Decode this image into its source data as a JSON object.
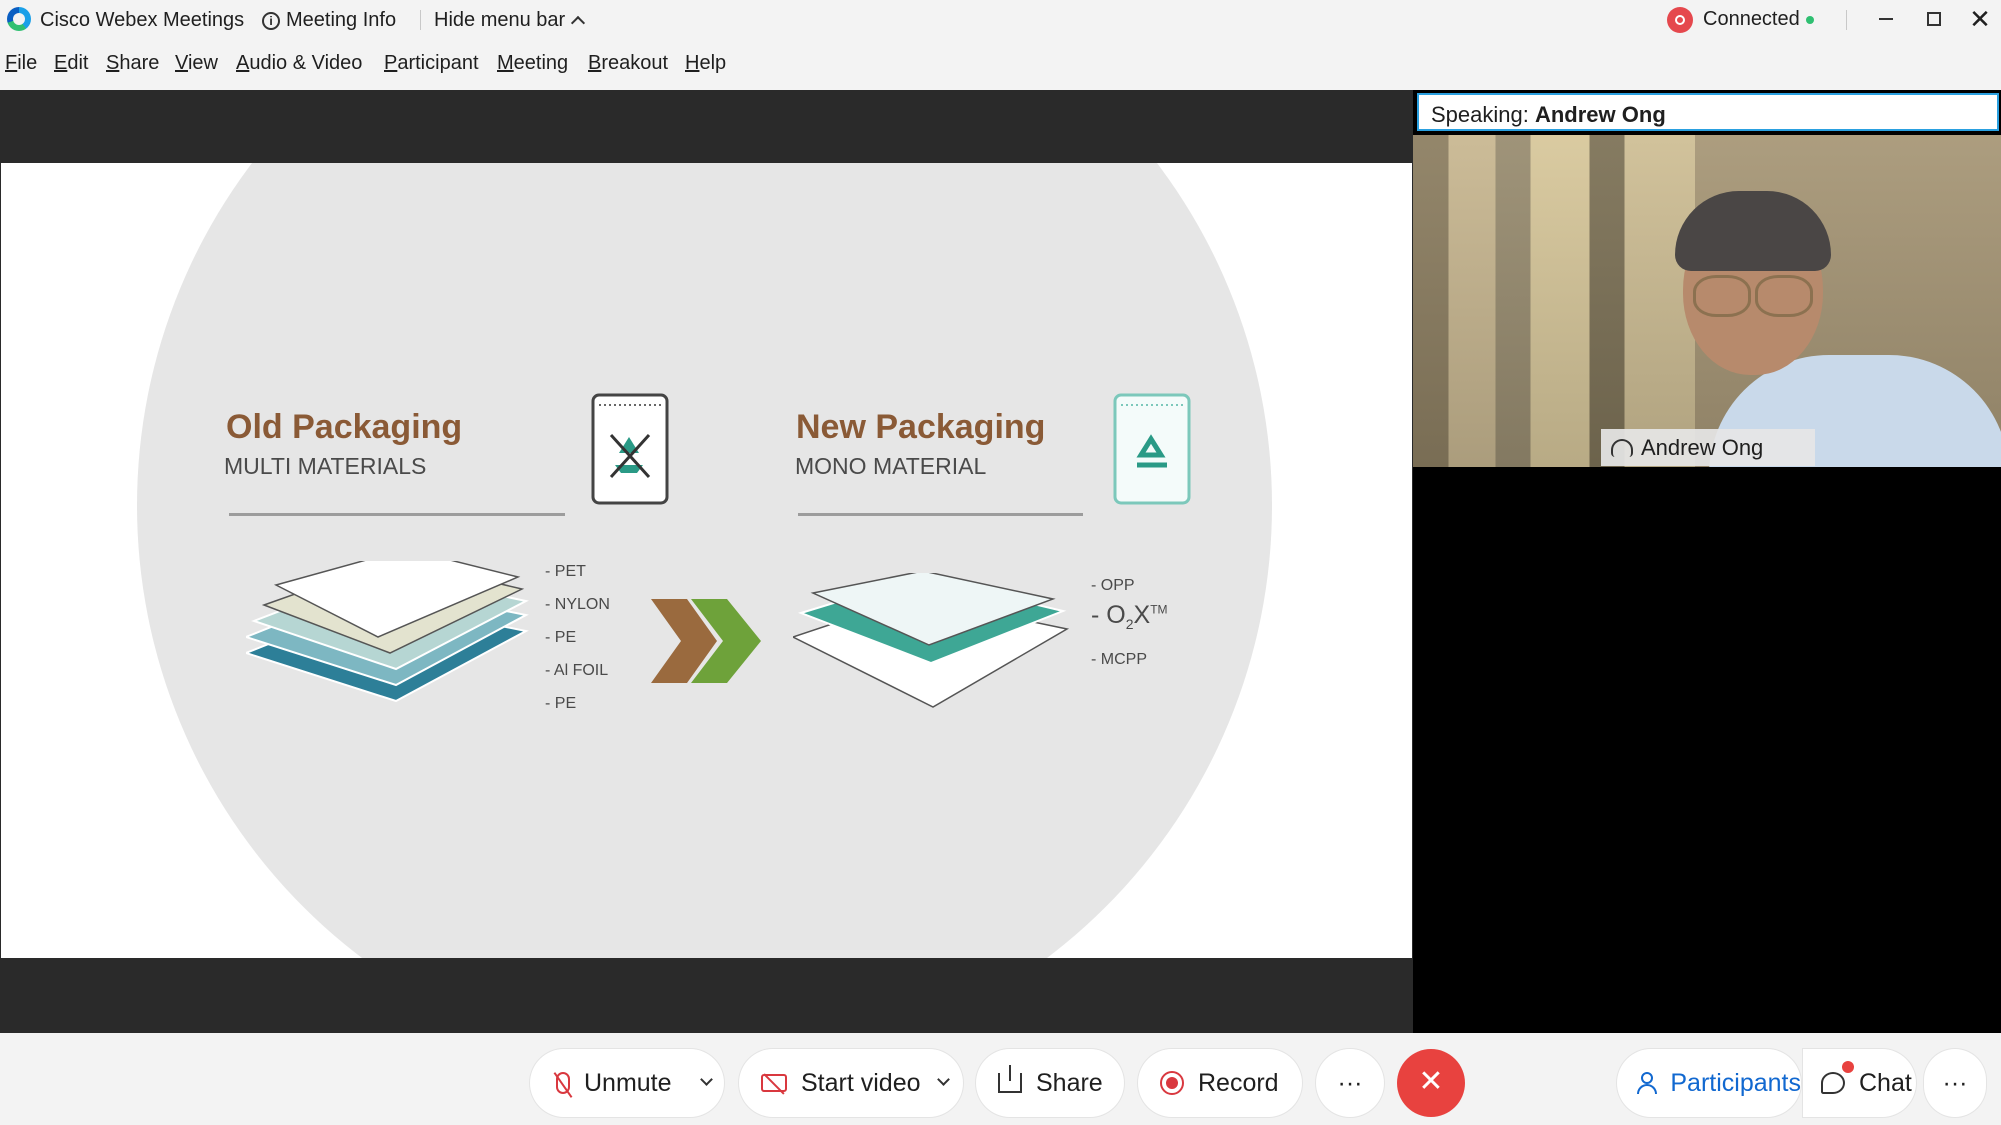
{
  "titlebar": {
    "app_title": "Cisco Webex Meetings",
    "meeting_info": "Meeting Info",
    "hide_menu_bar": "Hide menu bar",
    "connection_status": "Connected"
  },
  "menu": [
    "File",
    "Edit",
    "Share",
    "View",
    "Audio & Video",
    "Participant",
    "Meeting",
    "Breakout",
    "Help"
  ],
  "slide": {
    "old_title": "Old Packaging",
    "old_subtitle": "MULTI MATERIALS",
    "new_title": "New Packaging",
    "new_subtitle": "MONO MATERIAL",
    "old_layers": [
      "- PET",
      "- NYLON",
      "- PE",
      "- Al FOIL",
      "- PE"
    ],
    "new_layers": {
      "top": "- OPP",
      "middle_prefix": "- O",
      "middle_sub": "2",
      "middle_main": "X",
      "middle_sup": "TM",
      "bottom": "- MCPP"
    }
  },
  "right_panel": {
    "speaking_label": "Speaking:",
    "speaker_name": "Andrew Ong",
    "video_name_tag": "Andrew Ong"
  },
  "controls": {
    "unmute": "Unmute",
    "start_video": "Start video",
    "share": "Share",
    "record": "Record",
    "more": "···",
    "end": "✕",
    "participants": "Participants",
    "chat": "Chat",
    "overflow": "···"
  },
  "colors": {
    "brown_heading": "#8a5a36",
    "end_red": "#e8423f",
    "participants_blue": "#1168d0",
    "speaking_border": "#2aa0e0"
  }
}
